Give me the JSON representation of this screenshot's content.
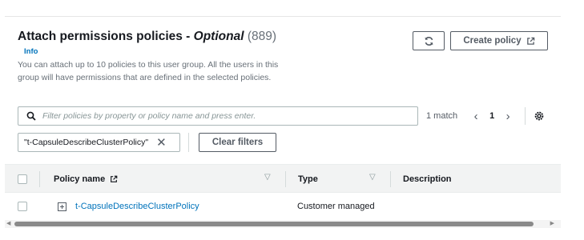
{
  "header": {
    "title": "Attach permissions policies - ",
    "title_optional": "Optional",
    "count": "(889)",
    "info": "Info",
    "description": "You can attach up to 10 policies to this user group. All the users in this group will have permissions that are defined in the selected policies."
  },
  "buttons": {
    "refresh_icon": "refresh-icon",
    "create_policy": "Create policy"
  },
  "search": {
    "placeholder": "Filter policies by property or policy name and press enter.",
    "value": ""
  },
  "pagination": {
    "match_text": "1 match",
    "current_page": "1"
  },
  "filter": {
    "token": "\"t-CapsuleDescribeClusterPolicy\"",
    "clear_label": "Clear filters"
  },
  "table": {
    "columns": {
      "policy_name": "Policy name",
      "type": "Type",
      "description": "Description"
    },
    "rows": [
      {
        "name": "t-CapsuleDescribeClusterPolicy",
        "type": "Customer managed",
        "description": ""
      }
    ]
  },
  "colors": {
    "link": "#0073bb",
    "border": "#545b64",
    "header_bg": "#f2f3f3"
  }
}
